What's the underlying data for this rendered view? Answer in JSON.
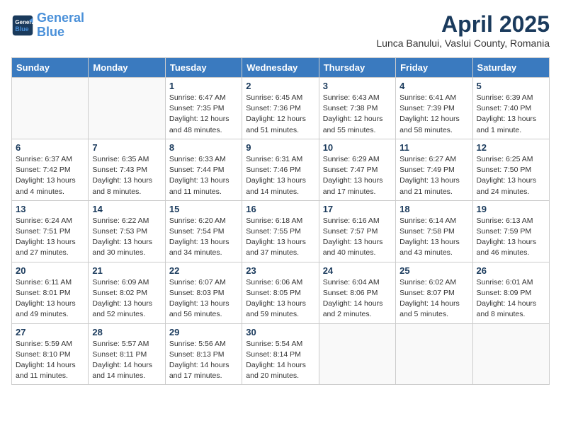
{
  "header": {
    "logo_line1": "General",
    "logo_line2": "Blue",
    "month_title": "April 2025",
    "subtitle": "Lunca Banului, Vaslui County, Romania"
  },
  "weekdays": [
    "Sunday",
    "Monday",
    "Tuesday",
    "Wednesday",
    "Thursday",
    "Friday",
    "Saturday"
  ],
  "weeks": [
    [
      {
        "day": "",
        "info": ""
      },
      {
        "day": "",
        "info": ""
      },
      {
        "day": "1",
        "info": "Sunrise: 6:47 AM\nSunset: 7:35 PM\nDaylight: 12 hours and 48 minutes."
      },
      {
        "day": "2",
        "info": "Sunrise: 6:45 AM\nSunset: 7:36 PM\nDaylight: 12 hours and 51 minutes."
      },
      {
        "day": "3",
        "info": "Sunrise: 6:43 AM\nSunset: 7:38 PM\nDaylight: 12 hours and 55 minutes."
      },
      {
        "day": "4",
        "info": "Sunrise: 6:41 AM\nSunset: 7:39 PM\nDaylight: 12 hours and 58 minutes."
      },
      {
        "day": "5",
        "info": "Sunrise: 6:39 AM\nSunset: 7:40 PM\nDaylight: 13 hours and 1 minute."
      }
    ],
    [
      {
        "day": "6",
        "info": "Sunrise: 6:37 AM\nSunset: 7:42 PM\nDaylight: 13 hours and 4 minutes."
      },
      {
        "day": "7",
        "info": "Sunrise: 6:35 AM\nSunset: 7:43 PM\nDaylight: 13 hours and 8 minutes."
      },
      {
        "day": "8",
        "info": "Sunrise: 6:33 AM\nSunset: 7:44 PM\nDaylight: 13 hours and 11 minutes."
      },
      {
        "day": "9",
        "info": "Sunrise: 6:31 AM\nSunset: 7:46 PM\nDaylight: 13 hours and 14 minutes."
      },
      {
        "day": "10",
        "info": "Sunrise: 6:29 AM\nSunset: 7:47 PM\nDaylight: 13 hours and 17 minutes."
      },
      {
        "day": "11",
        "info": "Sunrise: 6:27 AM\nSunset: 7:49 PM\nDaylight: 13 hours and 21 minutes."
      },
      {
        "day": "12",
        "info": "Sunrise: 6:25 AM\nSunset: 7:50 PM\nDaylight: 13 hours and 24 minutes."
      }
    ],
    [
      {
        "day": "13",
        "info": "Sunrise: 6:24 AM\nSunset: 7:51 PM\nDaylight: 13 hours and 27 minutes."
      },
      {
        "day": "14",
        "info": "Sunrise: 6:22 AM\nSunset: 7:53 PM\nDaylight: 13 hours and 30 minutes."
      },
      {
        "day": "15",
        "info": "Sunrise: 6:20 AM\nSunset: 7:54 PM\nDaylight: 13 hours and 34 minutes."
      },
      {
        "day": "16",
        "info": "Sunrise: 6:18 AM\nSunset: 7:55 PM\nDaylight: 13 hours and 37 minutes."
      },
      {
        "day": "17",
        "info": "Sunrise: 6:16 AM\nSunset: 7:57 PM\nDaylight: 13 hours and 40 minutes."
      },
      {
        "day": "18",
        "info": "Sunrise: 6:14 AM\nSunset: 7:58 PM\nDaylight: 13 hours and 43 minutes."
      },
      {
        "day": "19",
        "info": "Sunrise: 6:13 AM\nSunset: 7:59 PM\nDaylight: 13 hours and 46 minutes."
      }
    ],
    [
      {
        "day": "20",
        "info": "Sunrise: 6:11 AM\nSunset: 8:01 PM\nDaylight: 13 hours and 49 minutes."
      },
      {
        "day": "21",
        "info": "Sunrise: 6:09 AM\nSunset: 8:02 PM\nDaylight: 13 hours and 52 minutes."
      },
      {
        "day": "22",
        "info": "Sunrise: 6:07 AM\nSunset: 8:03 PM\nDaylight: 13 hours and 56 minutes."
      },
      {
        "day": "23",
        "info": "Sunrise: 6:06 AM\nSunset: 8:05 PM\nDaylight: 13 hours and 59 minutes."
      },
      {
        "day": "24",
        "info": "Sunrise: 6:04 AM\nSunset: 8:06 PM\nDaylight: 14 hours and 2 minutes."
      },
      {
        "day": "25",
        "info": "Sunrise: 6:02 AM\nSunset: 8:07 PM\nDaylight: 14 hours and 5 minutes."
      },
      {
        "day": "26",
        "info": "Sunrise: 6:01 AM\nSunset: 8:09 PM\nDaylight: 14 hours and 8 minutes."
      }
    ],
    [
      {
        "day": "27",
        "info": "Sunrise: 5:59 AM\nSunset: 8:10 PM\nDaylight: 14 hours and 11 minutes."
      },
      {
        "day": "28",
        "info": "Sunrise: 5:57 AM\nSunset: 8:11 PM\nDaylight: 14 hours and 14 minutes."
      },
      {
        "day": "29",
        "info": "Sunrise: 5:56 AM\nSunset: 8:13 PM\nDaylight: 14 hours and 17 minutes."
      },
      {
        "day": "30",
        "info": "Sunrise: 5:54 AM\nSunset: 8:14 PM\nDaylight: 14 hours and 20 minutes."
      },
      {
        "day": "",
        "info": ""
      },
      {
        "day": "",
        "info": ""
      },
      {
        "day": "",
        "info": ""
      }
    ]
  ]
}
